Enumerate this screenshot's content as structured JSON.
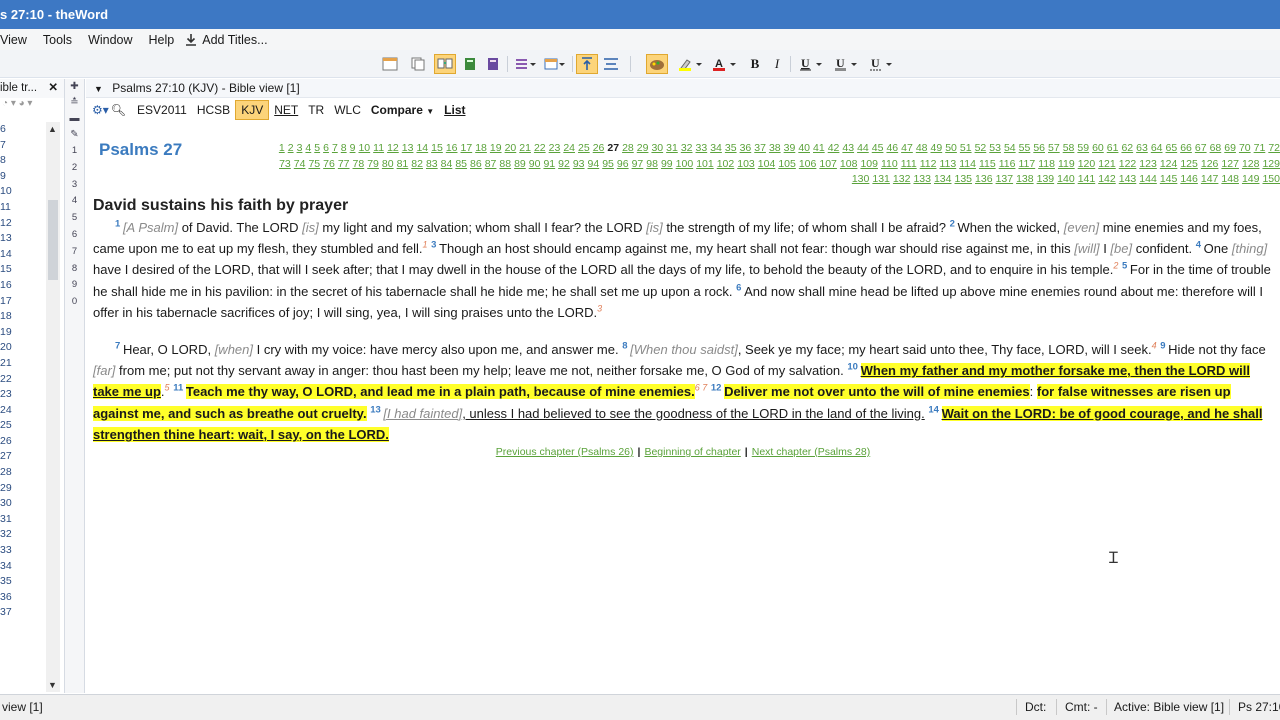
{
  "window": {
    "title": "s 27:10 - theWord"
  },
  "menu": {
    "view": "View",
    "tools": "Tools",
    "window": "Window",
    "help": "Help",
    "add_titles": "Add Titles..."
  },
  "left_pane": {
    "header": "ible tr...",
    "close": "✕",
    "numbers": [
      "6",
      "7",
      "8",
      "9",
      "10",
      "11",
      "12",
      "13",
      "14",
      "15",
      "16",
      "17",
      "18",
      "19",
      "20",
      "21",
      "22",
      "23",
      "24",
      "25",
      "26",
      "27",
      "28",
      "29",
      "30",
      "31",
      "32",
      "33",
      "34",
      "35",
      "36",
      "37"
    ]
  },
  "gutter": [
    "1",
    "2",
    "3",
    "4",
    "5",
    "6",
    "7",
    "8",
    "9",
    "0"
  ],
  "view": {
    "title": "Psalms 27:10 (KJV)  -  Bible view [1]"
  },
  "versions": {
    "esv": "ESV2011",
    "hcsb": "HCSB",
    "kjv": "KJV",
    "net": "NET",
    "tr": "TR",
    "wlc": "WLC",
    "compare": "Compare",
    "list": "List"
  },
  "chapter": {
    "heading": "Psalms 27",
    "current": "27",
    "count": 150
  },
  "section_title": "David sustains his faith by prayer",
  "verses": {
    "p1": [
      {
        "t": "vn",
        "v": "1 "
      },
      {
        "t": "it",
        "v": "[A Psalm]"
      },
      {
        "t": "tx",
        "v": " of David. The LORD "
      },
      {
        "t": "it",
        "v": "[is]"
      },
      {
        "t": "tx",
        "v": " my light and my salvation; whom shall I fear? the LORD "
      },
      {
        "t": "it",
        "v": "[is]"
      },
      {
        "t": "tx",
        "v": " the strength of my life; of whom shall I be afraid? "
      },
      {
        "t": "vn",
        "v": "2 "
      },
      {
        "t": "tx",
        "v": "When the wicked, "
      },
      {
        "t": "it",
        "v": "[even]"
      },
      {
        "t": "tx",
        "v": " mine enemies and my foes, came upon me to eat up my flesh, they stumbled and fell."
      },
      {
        "t": "fn",
        "v": "1"
      },
      {
        "t": "tx",
        "v": " "
      },
      {
        "t": "vn",
        "v": "3 "
      },
      {
        "t": "tx",
        "v": "Though an host should encamp against me, my heart shall not fear: though war should rise against me, in this "
      },
      {
        "t": "it",
        "v": "[will]"
      },
      {
        "t": "tx",
        "v": " I "
      },
      {
        "t": "it",
        "v": "[be]"
      },
      {
        "t": "tx",
        "v": " confident. "
      },
      {
        "t": "vn",
        "v": "4 "
      },
      {
        "t": "tx",
        "v": "One "
      },
      {
        "t": "it",
        "v": "[thing]"
      },
      {
        "t": "tx",
        "v": " have I desired of the LORD, that will I seek after; that I may dwell in the house of the LORD all the days of my life, to behold the beauty of the LORD, and to enquire in his temple."
      },
      {
        "t": "fn",
        "v": "2"
      },
      {
        "t": "tx",
        "v": " "
      },
      {
        "t": "vn",
        "v": "5 "
      },
      {
        "t": "tx",
        "v": "For in the time of trouble he shall hide me in his pavilion: in the secret of his tabernacle shall he hide me; he shall set me up upon a rock. "
      },
      {
        "t": "vn",
        "v": "6 "
      },
      {
        "t": "tx",
        "v": "And now shall mine head be lifted up above mine enemies round about me: therefore will I offer in his tabernacle sacrifices of joy; I will sing, yea, I will sing praises unto the LORD."
      },
      {
        "t": "fn",
        "v": "3"
      }
    ],
    "p2": [
      {
        "t": "vn",
        "v": "7 "
      },
      {
        "t": "tx",
        "v": "Hear, O LORD, "
      },
      {
        "t": "it",
        "v": "[when]"
      },
      {
        "t": "tx",
        "v": " I cry with my voice: have mercy also upon me, and answer me. "
      },
      {
        "t": "vn",
        "v": "8 "
      },
      {
        "t": "it",
        "v": "[When thou saidst]"
      },
      {
        "t": "tx",
        "v": ", Seek ye my face; my heart said unto thee, Thy face, LORD, will I seek."
      },
      {
        "t": "fn",
        "v": "4"
      },
      {
        "t": "tx",
        "v": " "
      },
      {
        "t": "vn",
        "v": "9 "
      },
      {
        "t": "tx",
        "v": "Hide not thy face "
      },
      {
        "t": "it",
        "v": "[far]"
      },
      {
        "t": "tx",
        "v": " from me; put not thy servant away in anger: thou hast been my help; leave me not, neither forsake me, O God of my salvation. "
      },
      {
        "t": "vn",
        "v": "10 "
      },
      {
        "t": "hlu",
        "v": "When my father and my mother forsake me, then the LORD will take me up"
      },
      {
        "t": "tx",
        "v": "."
      },
      {
        "t": "fn",
        "v": "5"
      },
      {
        "t": "tx",
        "v": " "
      },
      {
        "t": "vn",
        "v": "11 "
      },
      {
        "t": "hl",
        "v": "Teach me thy way, O LORD, and lead me in a plain path, because of mine enemies."
      },
      {
        "t": "fn",
        "v": "6 7"
      },
      {
        "t": "tx",
        "v": " "
      },
      {
        "t": "vn",
        "v": "12 "
      },
      {
        "t": "hl",
        "v": "Deliver me not over unto the will of mine enemies"
      },
      {
        "t": "tx",
        "v": ": "
      },
      {
        "t": "hl",
        "v": "for false witnesses are risen up against me, and such as breathe out cruelty."
      },
      {
        "t": "tx",
        "v": " "
      },
      {
        "t": "vn",
        "v": "13 "
      },
      {
        "t": "itu",
        "v": "[I had fainted]"
      },
      {
        "t": "ul",
        "v": ", unless I had believed to see the goodness of the LORD in the land of the living."
      },
      {
        "t": "tx",
        "v": " "
      },
      {
        "t": "vn",
        "v": "14 "
      },
      {
        "t": "hlu",
        "v": "Wait on the LORD: be of good courage, and he shall strengthen thine heart: wait, I say, on the LORD."
      }
    ]
  },
  "nav": {
    "prev": "Previous chapter (Psalms 26)",
    "begin": "Beginning of chapter",
    "next": "Next chapter (Psalms 28)"
  },
  "status": {
    "left": "view [1]",
    "dct": "Dct:",
    "cmt": "Cmt: -",
    "active": "Active: Bible view [1]",
    "ref": "Ps 27:10"
  }
}
